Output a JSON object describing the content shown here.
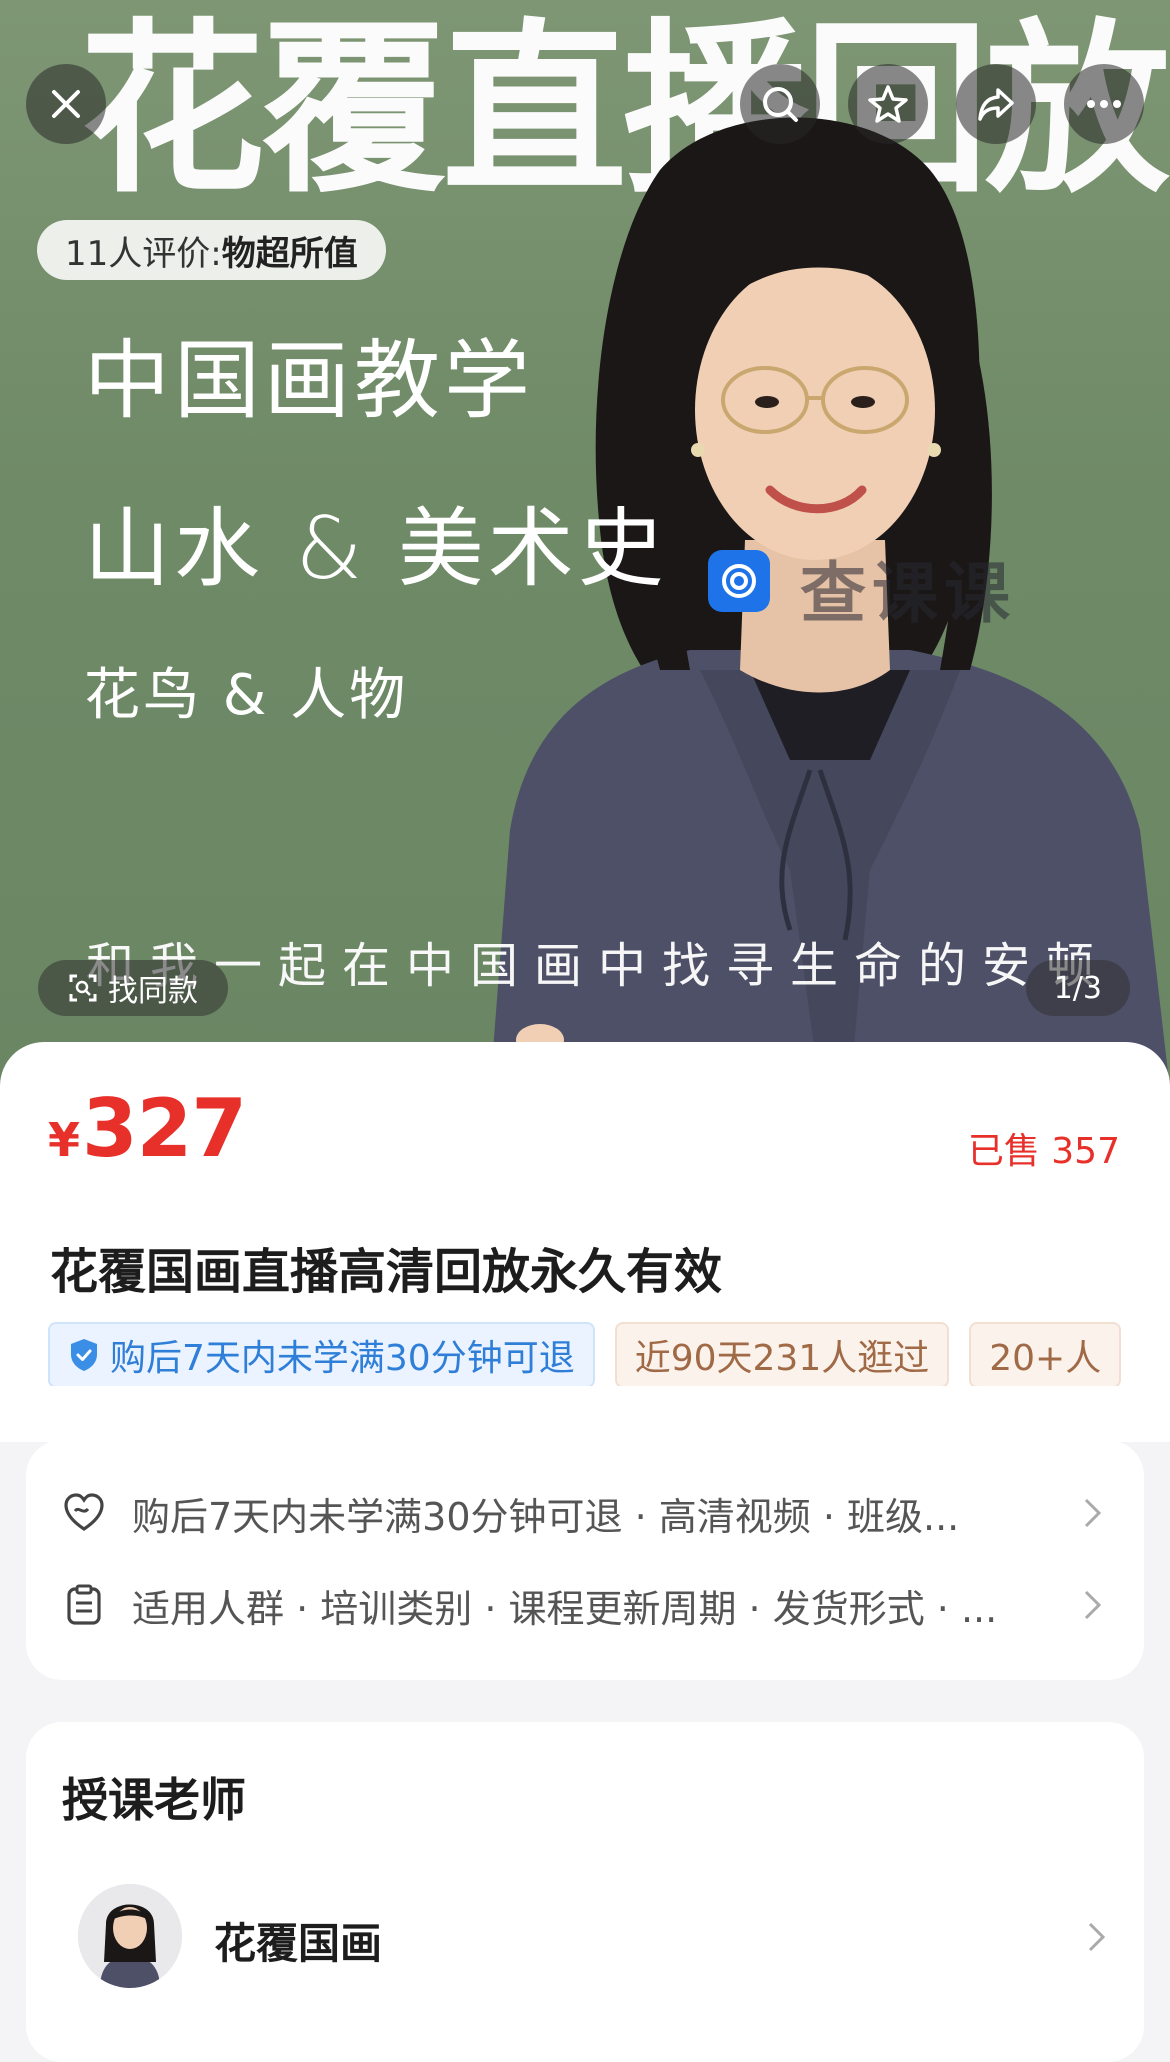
{
  "hero": {
    "big_title": "花覆直播回放",
    "rating_prefix": "11人评价:",
    "rating_value": "物超所值",
    "line1": "中国画教学",
    "line2": "山水 & 美术史",
    "line3": "花鸟 & 人物",
    "motto": "和我一起在中国画中找寻生命的安顿",
    "watermark": "查课课",
    "find_similar_label": "找同款",
    "page_counter": "1/3"
  },
  "top_actions": {
    "close_icon": "close-icon",
    "search_icon": "search-icon",
    "favorite_icon": "star-icon",
    "share_icon": "share-icon",
    "more_icon": "more-icon"
  },
  "product": {
    "currency": "¥",
    "price": "327",
    "sold": "已售 357",
    "title": "花覆国画直播高清回放永久有效",
    "tags": [
      "购后7天内未学满30分钟可退",
      "近90天231人逛过",
      "20+人"
    ]
  },
  "info": {
    "row1": "购后7天内未学满30分钟可退 · 高清视频 · 班级...",
    "row2": "适用人群 · 培训类别 · 课程更新周期 · 发货形式 · ..."
  },
  "teacher": {
    "heading": "授课老师",
    "name": "花覆国画"
  },
  "colors": {
    "price_red": "#e8302a",
    "hero_green": "#6f8a67",
    "tag_blue": "#2f7fd8"
  }
}
